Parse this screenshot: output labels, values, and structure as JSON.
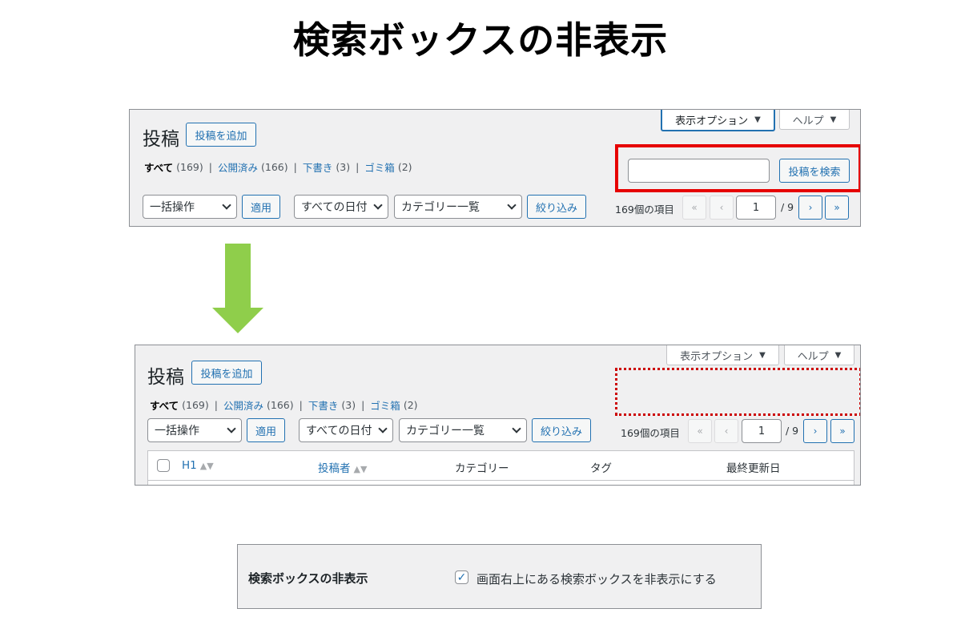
{
  "headline": "検索ボックスの非表示",
  "screen_before": {
    "title": "投稿",
    "add_new": "投稿を追加",
    "screen_options": "表示オプション",
    "help": "ヘルプ",
    "views": {
      "all": "すべて",
      "all_count": "(169)",
      "publish": "公開済み",
      "publish_count": "(166)",
      "draft": "下書き",
      "draft_count": "(3)",
      "trash": "ゴミ箱",
      "trash_count": "(2)",
      "separator": "|"
    },
    "search_input_value": "",
    "search_button": "投稿を検索",
    "bulk_action": "一括操作",
    "apply": "適用",
    "date_filter": "すべての日付",
    "category_filter": "カテゴリー一覧",
    "filter_button": "絞り込み",
    "pagination": {
      "count": "169個の項目",
      "first": "«",
      "prev": "‹",
      "current_page": "1",
      "total": "/ 9",
      "next": "›",
      "last": "»"
    }
  },
  "screen_after": {
    "title": "投稿",
    "add_new": "投稿を追加",
    "screen_options": "表示オプション",
    "help": "ヘルプ",
    "views": {
      "all": "すべて",
      "all_count": "(169)",
      "publish": "公開済み",
      "publish_count": "(166)",
      "draft": "下書き",
      "draft_count": "(3)",
      "trash": "ゴミ箱",
      "trash_count": "(2)",
      "separator": "|"
    },
    "bulk_action": "一括操作",
    "apply": "適用",
    "date_filter": "すべての日付",
    "category_filter": "カテゴリー一覧",
    "filter_button": "絞り込み",
    "pagination": {
      "count": "169個の項目",
      "first": "«",
      "prev": "‹",
      "current_page": "1",
      "total": "/ 9",
      "next": "›",
      "last": "»"
    },
    "columns": {
      "h1": "H1",
      "author": "投稿者",
      "category": "カテゴリー",
      "tag": "タグ",
      "modified": "最終更新日"
    }
  },
  "option": {
    "label": "検索ボックスの非表示",
    "checkbox_text": "画面右上にある検索ボックスを非表示にする",
    "checked": true,
    "check_mark": "✓"
  },
  "colors": {
    "wp_blue": "#2271b1",
    "highlight_red": "#e60000",
    "arrow_green": "#8fce4b",
    "panel_bg": "#f0f0f1"
  },
  "icons": {
    "dropdown": "triangle-down-icon",
    "select": "chevron-down-icon",
    "sort": "sort-arrows-icon",
    "arrow": "down-arrow-icon",
    "checkbox": "checkmark-icon"
  }
}
